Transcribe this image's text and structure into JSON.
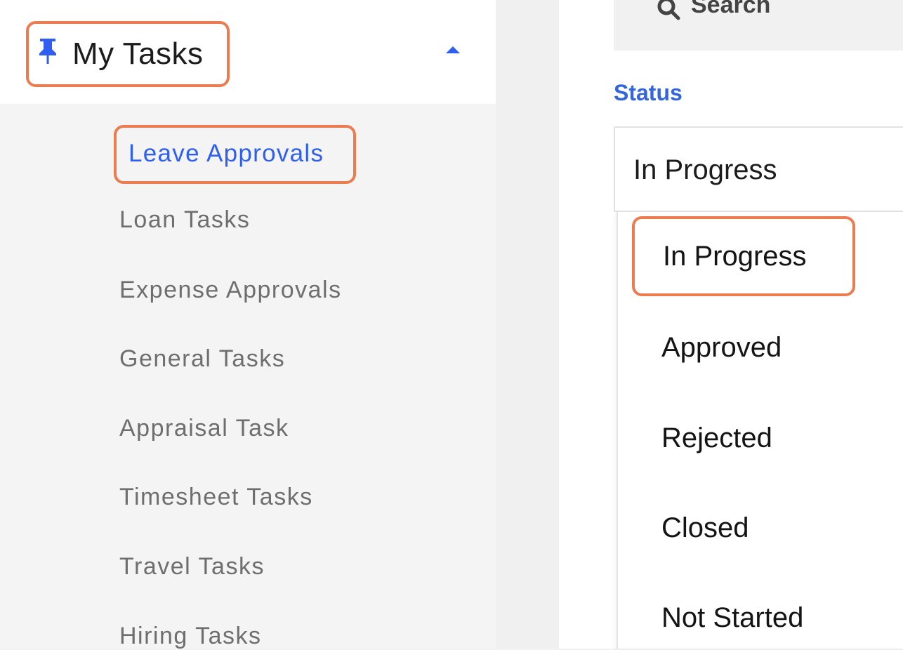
{
  "sidebar": {
    "title": "My Tasks",
    "pin_icon": "pin-icon",
    "collapse_icon": "caret-up-icon",
    "items": [
      {
        "label": "Leave Approvals",
        "active": true
      },
      {
        "label": "Loan Tasks",
        "active": false
      },
      {
        "label": "Expense Approvals",
        "active": false
      },
      {
        "label": "General Tasks",
        "active": false
      },
      {
        "label": "Appraisal Task",
        "active": false
      },
      {
        "label": "Timesheet Tasks",
        "active": false
      },
      {
        "label": "Travel Tasks",
        "active": false
      },
      {
        "label": "Hiring Tasks",
        "active": false
      }
    ]
  },
  "main": {
    "search": {
      "label": "Search",
      "icon": "search-icon"
    },
    "status": {
      "label": "Status",
      "selected": "In Progress",
      "options": [
        "In Progress",
        "Approved",
        "Rejected",
        "Closed",
        "Not Started"
      ],
      "highlighted": "In Progress"
    }
  },
  "colors": {
    "accent": "#2f5ff0",
    "highlight_border": "#eb7c4f",
    "status_label": "#3366dd"
  }
}
